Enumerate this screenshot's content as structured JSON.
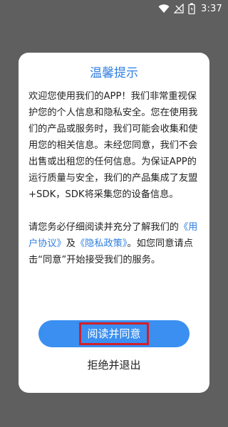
{
  "status_bar": {
    "time": "3:37",
    "icons": [
      "wifi-icon",
      "signal-icon",
      "battery-icon"
    ]
  },
  "dialog": {
    "title": "温馨提示",
    "para1": "欢迎您使用我们的APP！我们非常重视保护您的个人信息和隐私安全。您在使用我们的产品或服务时，我们可能会收集和使用您的相关信息。未经您同意，我们不会出售或出租您的任何信息。为保证APP的运行质量与安全，我们的产品集成了友盟+SDK，SDK将采集您的设备信息。",
    "para2": {
      "prefix": "请您务必仔细阅读并充分了解我们的",
      "user_agreement": "《用户协议》",
      "and": "及",
      "privacy_policy": "《隐私政策》",
      "suffix": "。如您同意请点击“同意”开始接受我们的服务。"
    },
    "agree_label": "阅读并同意",
    "reject_label": "拒绝并退出"
  },
  "colors": {
    "overlay": "#5f5f5f",
    "accent": "#2f7fe0",
    "button": "#3a8ff0",
    "highlight_box": "#d0202a"
  }
}
